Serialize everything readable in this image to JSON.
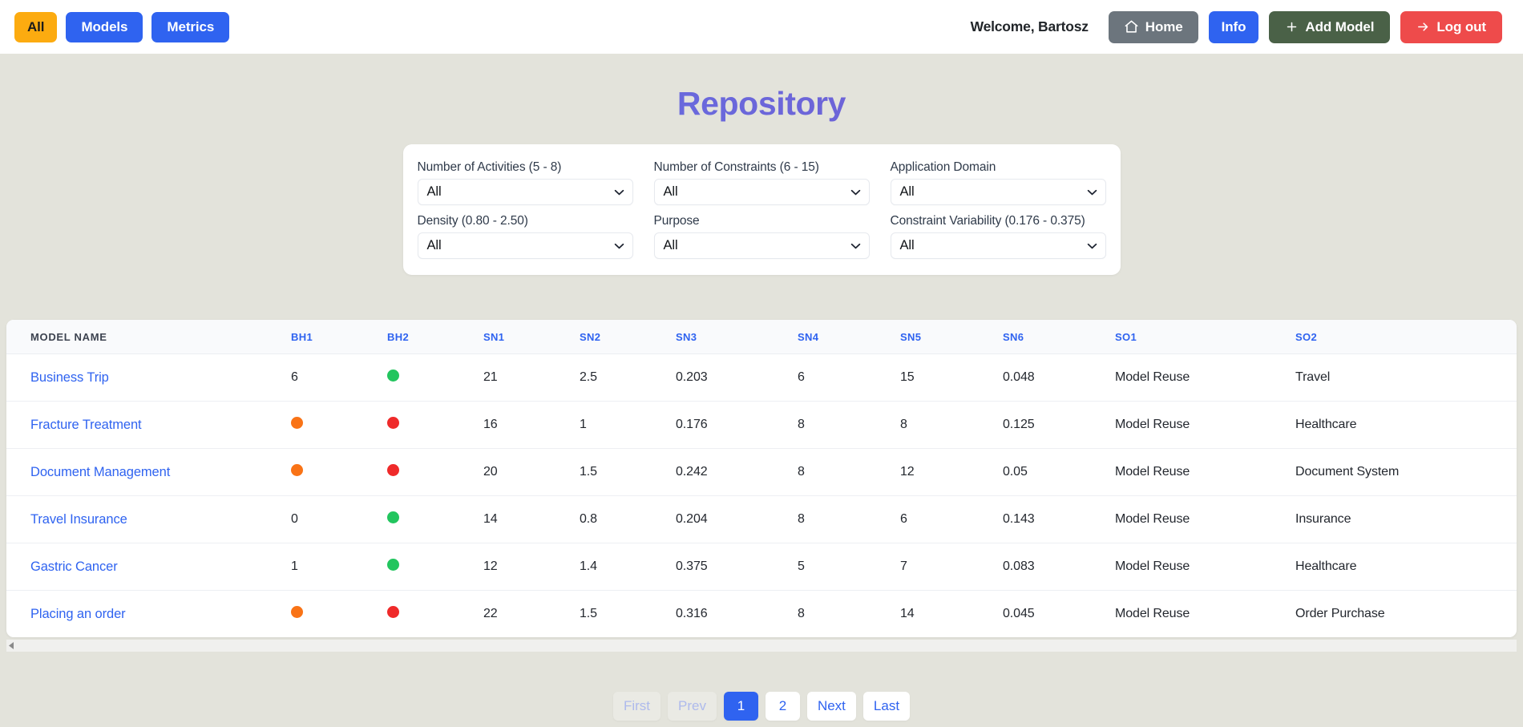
{
  "topbar": {
    "left_buttons": [
      {
        "label": "All",
        "style": "amber"
      },
      {
        "label": "Models",
        "style": "blue"
      },
      {
        "label": "Metrics",
        "style": "blue"
      }
    ],
    "welcome": "Welcome, Bartosz",
    "home_label": "Home",
    "info_label": "Info",
    "add_model_label": "Add Model",
    "logout_label": "Log out",
    "colors": {
      "amber": "#fcab10",
      "blue": "#2f63f0",
      "grey": "#6c757d",
      "green": "#4a6147",
      "red": "#ee4b4b"
    }
  },
  "page": {
    "title": "Repository",
    "title_gradient_from": "#5b7ef0",
    "title_gradient_to": "#7b4fc4",
    "background": "#e3e3db"
  },
  "filters": [
    {
      "label": "Number of Activities (5 - 8)",
      "value": "All"
    },
    {
      "label": "Number of Constraints (6 - 15)",
      "value": "All"
    },
    {
      "label": "Application Domain",
      "value": "All"
    },
    {
      "label": "Density (0.80 - 2.50)",
      "value": "All"
    },
    {
      "label": "Purpose",
      "value": "All"
    },
    {
      "label": "Constraint Variability (0.176 - 0.375)",
      "value": "All"
    }
  ],
  "table": {
    "headers": [
      "MODEL NAME",
      "BH1",
      "BH2",
      "SN1",
      "SN2",
      "SN3",
      "SN4",
      "SN5",
      "SN6",
      "SO1",
      "SO2"
    ],
    "rows": [
      {
        "name": "Business Trip",
        "bh1": {
          "type": "text",
          "value": "6"
        },
        "bh2": {
          "type": "dot",
          "color": "#22c55e"
        },
        "sn1": "21",
        "sn2": "2.5",
        "sn3": "0.203",
        "sn4": "6",
        "sn5": "15",
        "sn6": "0.048",
        "so1": "Model Reuse",
        "so2": "Travel"
      },
      {
        "name": "Fracture Treatment",
        "bh1": {
          "type": "dot",
          "color": "#f97316"
        },
        "bh2": {
          "type": "dot",
          "color": "#ef2a2a"
        },
        "sn1": "16",
        "sn2": "1",
        "sn3": "0.176",
        "sn4": "8",
        "sn5": "8",
        "sn6": "0.125",
        "so1": "Model Reuse",
        "so2": "Healthcare"
      },
      {
        "name": "Document Management",
        "bh1": {
          "type": "dot",
          "color": "#f97316"
        },
        "bh2": {
          "type": "dot",
          "color": "#ef2a2a"
        },
        "sn1": "20",
        "sn2": "1.5",
        "sn3": "0.242",
        "sn4": "8",
        "sn5": "12",
        "sn6": "0.05",
        "so1": "Model Reuse",
        "so2": "Document System"
      },
      {
        "name": "Travel Insurance",
        "bh1": {
          "type": "text",
          "value": "0"
        },
        "bh2": {
          "type": "dot",
          "color": "#22c55e"
        },
        "sn1": "14",
        "sn2": "0.8",
        "sn3": "0.204",
        "sn4": "8",
        "sn5": "6",
        "sn6": "0.143",
        "so1": "Model Reuse",
        "so2": "Insurance"
      },
      {
        "name": "Gastric Cancer",
        "bh1": {
          "type": "text",
          "value": "1"
        },
        "bh2": {
          "type": "dot",
          "color": "#22c55e"
        },
        "sn1": "12",
        "sn2": "1.4",
        "sn3": "0.375",
        "sn4": "5",
        "sn5": "7",
        "sn6": "0.083",
        "so1": "Model Reuse",
        "so2": "Healthcare"
      },
      {
        "name": "Placing an order",
        "bh1": {
          "type": "dot",
          "color": "#f97316"
        },
        "bh2": {
          "type": "dot",
          "color": "#ef2a2a"
        },
        "sn1": "22",
        "sn2": "1.5",
        "sn3": "0.316",
        "sn4": "8",
        "sn5": "14",
        "sn6": "0.045",
        "so1": "Model Reuse",
        "so2": "Order Purchase"
      }
    ]
  },
  "pagination": {
    "first": "First",
    "prev": "Prev",
    "pages": [
      "1",
      "2"
    ],
    "active_page": "1",
    "next": "Next",
    "last": "Last"
  }
}
